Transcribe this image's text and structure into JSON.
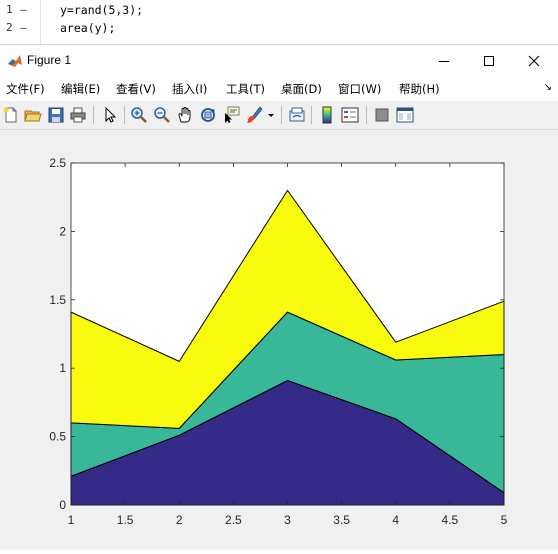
{
  "editor": {
    "lines": [
      {
        "number": "1",
        "marker": "–",
        "code": "y=rand(5,3);"
      },
      {
        "number": "2",
        "marker": "–",
        "code": "area(y);"
      }
    ]
  },
  "window": {
    "title": "Figure 1",
    "minimize_icon": "minimize-icon",
    "maximize_icon": "maximize-icon",
    "close_icon": "close-icon"
  },
  "menu": {
    "items": [
      {
        "label": "文件(F)"
      },
      {
        "label": "编辑(E)"
      },
      {
        "label": "查看(V)"
      },
      {
        "label": "插入(I)"
      },
      {
        "label": "工具(T)"
      },
      {
        "label": "桌面(D)"
      },
      {
        "label": "窗口(W)"
      },
      {
        "label": "帮助(H)"
      }
    ],
    "dock_arrow": "↘"
  },
  "toolbar": {
    "icons": [
      "new-figure-icon",
      "open-file-icon",
      "save-icon",
      "print-icon",
      "pointer-icon",
      "zoom-in-icon",
      "zoom-out-icon",
      "pan-hand-icon",
      "rotate-3d-icon",
      "data-cursor-icon",
      "brush-icon",
      "brush-dropdown-icon",
      "link-plot-icon",
      "colorbar-icon",
      "legend-icon",
      "hide-plot-tools-icon",
      "show-plot-tools-icon"
    ]
  },
  "chart_data": {
    "type": "area",
    "x": [
      1,
      2,
      3,
      4,
      5
    ],
    "series": [
      {
        "values": [
          0.21,
          0.51,
          0.91,
          0.63,
          0.09
        ],
        "color": "#352a87"
      },
      {
        "values": [
          0.39,
          0.05,
          0.5,
          0.43,
          1.01
        ],
        "color": "#38b899"
      },
      {
        "values": [
          0.81,
          0.49,
          0.89,
          0.13,
          0.39
        ],
        "color": "#f9fb0e"
      }
    ],
    "xlim": [
      1,
      5
    ],
    "ylim": [
      0,
      2.5
    ],
    "xticks": [
      "1",
      "1.5",
      "2",
      "2.5",
      "3",
      "3.5",
      "4",
      "4.5",
      "5"
    ],
    "yticks": [
      "0",
      "0.5",
      "1",
      "1.5",
      "2",
      "2.5"
    ],
    "stacked": true,
    "grid": false
  }
}
